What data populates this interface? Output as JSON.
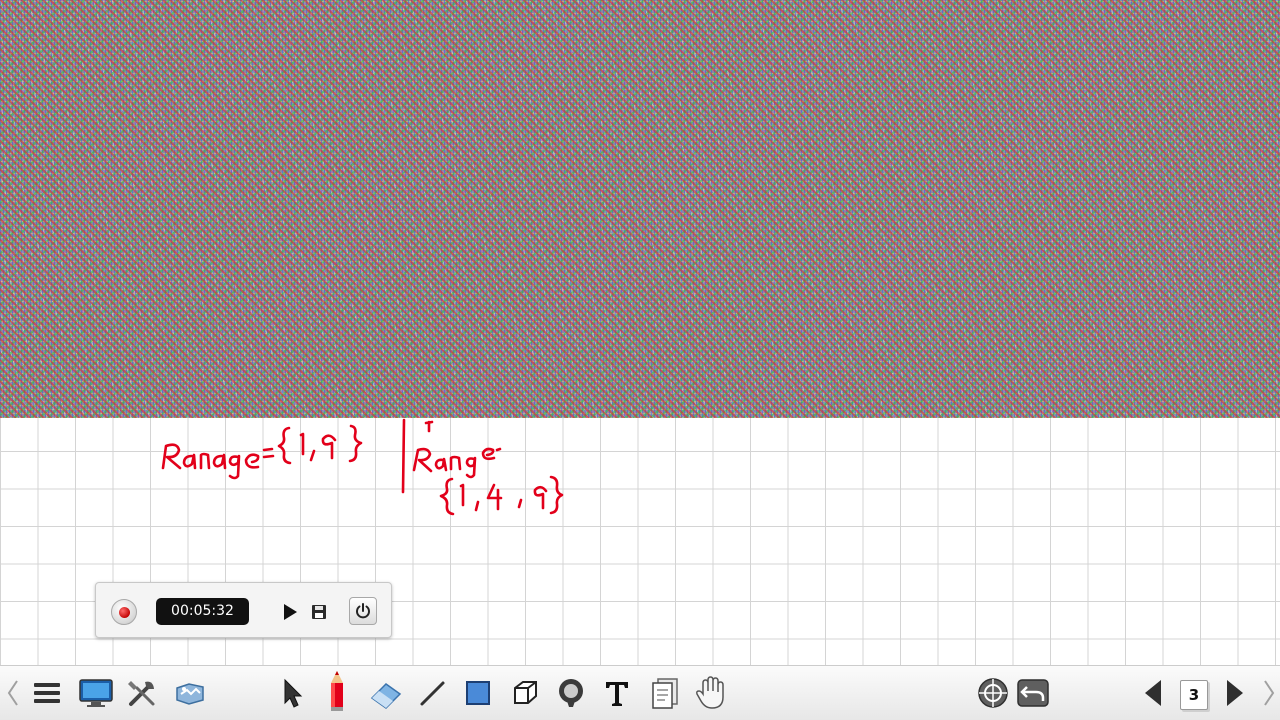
{
  "recorder": {
    "elapsed_time": "00:05:32"
  },
  "toolbar": {
    "tools": [
      "menu-icon",
      "display-icon",
      "tools-icon",
      "gallery-icon",
      "select-arrow-icon",
      "pen-icon",
      "eraser-icon",
      "line-icon",
      "rectangle-icon",
      "cube-icon",
      "spotlight-icon",
      "text-icon",
      "pages-icon",
      "hand-icon"
    ],
    "right_tools": [
      "target-icon",
      "undo-icon"
    ]
  },
  "navigation": {
    "page_number": "3"
  },
  "board": {
    "ink_color": "#e2001a",
    "grid_color": "#d4d4d4"
  }
}
